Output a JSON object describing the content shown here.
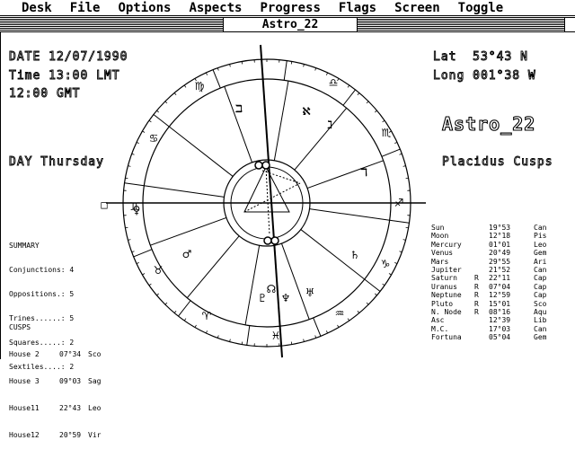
{
  "menu": [
    "Desk",
    "File",
    "Options",
    "Aspects",
    "Progress",
    "Flags",
    "Screen",
    "Toggle"
  ],
  "window_title": "Astro_22",
  "header": {
    "date": "DATE 12/07/1990",
    "time": "Time 13:00 LMT",
    "gmt": "12:00 GMT",
    "lat": "Lat  53°43 N",
    "long": "Long 001°38 W",
    "logo": "Astro_22",
    "day": "DAY Thursday",
    "house_system": "Placidus Cusps"
  },
  "summary": {
    "title": "SUMMARY",
    "lines": [
      "Conjunctions: 4",
      "Oppositions.: 5",
      "Trines......: 5",
      "Squares.....: 2",
      "Sextiles....: 2"
    ]
  },
  "cusps": {
    "title": "CUSPS",
    "rows": [
      {
        "house": "House 2",
        "pos": "07°34",
        "sign": "Sco"
      },
      {
        "house": "House 3",
        "pos": "09°03",
        "sign": "Sag"
      },
      {
        "house": "House11",
        "pos": "22°43",
        "sign": "Leo"
      },
      {
        "house": "House12",
        "pos": "20°59",
        "sign": "Vir"
      }
    ]
  },
  "planets": [
    {
      "name": "Sun",
      "r": "",
      "pos": "19°53",
      "sign": "Can"
    },
    {
      "name": "Moon",
      "r": "",
      "pos": "12°18",
      "sign": "Pis"
    },
    {
      "name": "Mercury",
      "r": "",
      "pos": "01°01",
      "sign": "Leo"
    },
    {
      "name": "Venus",
      "r": "",
      "pos": "20°49",
      "sign": "Gem"
    },
    {
      "name": "Mars",
      "r": "",
      "pos": "29°55",
      "sign": "Ari"
    },
    {
      "name": "Jupiter",
      "r": "",
      "pos": "21°52",
      "sign": "Can"
    },
    {
      "name": "Saturn",
      "r": "R",
      "pos": "22°11",
      "sign": "Cap"
    },
    {
      "name": "Uranus",
      "r": "R",
      "pos": "07°04",
      "sign": "Cap"
    },
    {
      "name": "Neptune",
      "r": "R",
      "pos": "12°59",
      "sign": "Cap"
    },
    {
      "name": "Pluto",
      "r": "R",
      "pos": "15°01",
      "sign": "Sco"
    },
    {
      "name": "N. Node",
      "r": "R",
      "pos": "08°16",
      "sign": "Aqu"
    },
    {
      "name": "Asc",
      "r": "",
      "pos": "12°39",
      "sign": "Lib"
    },
    {
      "name": "M.C.",
      "r": "",
      "pos": "17°03",
      "sign": "Can"
    },
    {
      "name": "Fortuna",
      "r": "",
      "pos": "05°04",
      "sign": "Gem"
    }
  ],
  "chart_glyphs": {
    "sign_glyphs": [
      "♍",
      "♎",
      "♏",
      "♐",
      "♑",
      "♒",
      "♓",
      "♈",
      "♉",
      "♊",
      "♋",
      "♌"
    ],
    "planet_glyphs": [
      "ℶ",
      "ℵ",
      "ℷ",
      "ℸ",
      "♄",
      "♅",
      "♆",
      "♇",
      "☊",
      "♂",
      "♀",
      "☽",
      "☉",
      "☿"
    ]
  }
}
